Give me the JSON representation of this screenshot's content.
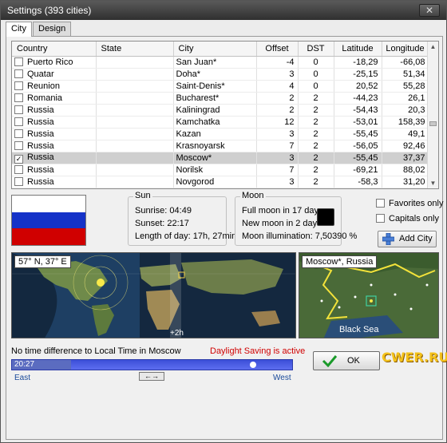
{
  "window": {
    "title": "Settings (393 cities)",
    "close_glyph": "✕"
  },
  "tabs": [
    {
      "label": "City"
    },
    {
      "label": "Design"
    }
  ],
  "table": {
    "headers": {
      "country": "Country",
      "state": "State",
      "city": "City",
      "offset": "Offset",
      "dst": "DST",
      "latitude": "Latitude",
      "longitude": "Longitude"
    },
    "rows": [
      {
        "checked": false,
        "country": "Puerto Rico",
        "state": "",
        "city": "San Juan*",
        "offset": "-4",
        "dst": "0",
        "latitude": "-18,29",
        "longitude": "-66,08"
      },
      {
        "checked": false,
        "country": "Quatar",
        "state": "",
        "city": "Doha*",
        "offset": "3",
        "dst": "0",
        "latitude": "-25,15",
        "longitude": "51,34"
      },
      {
        "checked": false,
        "country": "Reunion",
        "state": "",
        "city": "Saint-Denis*",
        "offset": "4",
        "dst": "0",
        "latitude": "20,52",
        "longitude": "55,28"
      },
      {
        "checked": false,
        "country": "Romania",
        "state": "",
        "city": "Bucharest*",
        "offset": "2",
        "dst": "2",
        "latitude": "-44,23",
        "longitude": "26,1"
      },
      {
        "checked": false,
        "country": "Russia",
        "state": "",
        "city": "Kaliningrad",
        "offset": "2",
        "dst": "2",
        "latitude": "-54,43",
        "longitude": "20,3"
      },
      {
        "checked": false,
        "country": "Russia",
        "state": "",
        "city": "Kamchatka",
        "offset": "12",
        "dst": "2",
        "latitude": "-53,01",
        "longitude": "158,39"
      },
      {
        "checked": false,
        "country": "Russia",
        "state": "",
        "city": "Kazan",
        "offset": "3",
        "dst": "2",
        "latitude": "-55,45",
        "longitude": "49,1"
      },
      {
        "checked": false,
        "country": "Russia",
        "state": "",
        "city": "Krasnoyarsk",
        "offset": "7",
        "dst": "2",
        "latitude": "-56,05",
        "longitude": "92,46"
      },
      {
        "checked": true,
        "country": "Russia",
        "state": "",
        "city": "Moscow*",
        "offset": "3",
        "dst": "2",
        "latitude": "-55,45",
        "longitude": "37,37"
      },
      {
        "checked": false,
        "country": "Russia",
        "state": "",
        "city": "Norilsk",
        "offset": "7",
        "dst": "2",
        "latitude": "-69,21",
        "longitude": "88,02"
      },
      {
        "checked": false,
        "country": "Russia",
        "state": "",
        "city": "Novgorod",
        "offset": "3",
        "dst": "2",
        "latitude": "-58,3",
        "longitude": "31,20"
      }
    ]
  },
  "flag": {
    "colors": [
      "#ffffff",
      "#1532c8",
      "#d00000"
    ]
  },
  "sun": {
    "title": "Sun",
    "sunrise": "Sunrise:  04:49",
    "sunset": "Sunset:  22:17",
    "length": "Length of day: 17h, 27min"
  },
  "moon": {
    "title": "Moon",
    "full": "Full moon in 17 days",
    "new": "New moon in 2 days",
    "illumination": "Moon illumination: 7,50390 %"
  },
  "options": {
    "favorites_only": "Favorites only",
    "capitals_only": "Capitals only",
    "add_city": "Add City"
  },
  "world_map": {
    "coords_label": "57° N, 37° E",
    "shift_label": "+2h"
  },
  "local_map": {
    "label": "Moscow*, Russia",
    "sea_label": "Black Sea"
  },
  "footer": {
    "status": "No time difference to Local Time in Moscow",
    "dst_status": "Daylight Saving is active",
    "time_value": "20:27",
    "east": "East",
    "west": "West",
    "swap_glyph": "←→",
    "ok": "OK"
  },
  "watermark": "CWER.RU"
}
